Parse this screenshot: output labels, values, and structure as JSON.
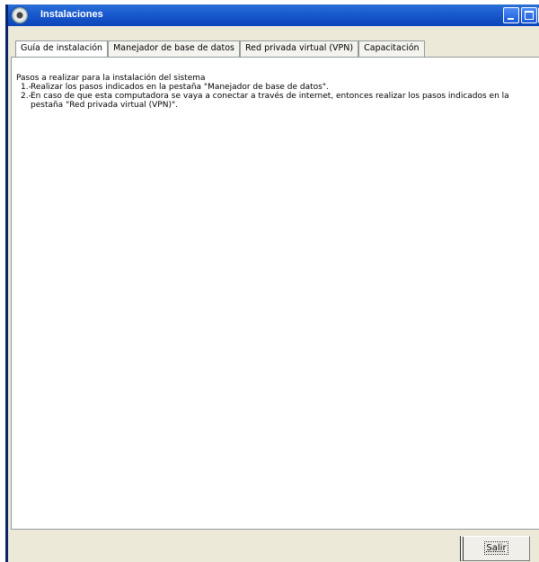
{
  "window": {
    "title": "Instalaciones"
  },
  "tabs": [
    {
      "label": "Guía de instalación",
      "active": true
    },
    {
      "label": "Manejador de base de datos",
      "active": false
    },
    {
      "label": "Red privada virtual (VPN)",
      "active": false
    },
    {
      "label": "Capacitación",
      "active": false
    }
  ],
  "content": {
    "intro": "Pasos a realizar para la instalación del sistema",
    "steps": [
      {
        "num": "1.-",
        "text": "Realizar los pasos indicados en la pestaña \"Manejador de base de datos\"."
      },
      {
        "num": "2.-",
        "text": "En caso de que esta computadora se vaya a conectar a través de internet, entonces realizar los pasos indicados en la pestaña \"Red privada virtual (VPN)\"."
      }
    ]
  },
  "footer": {
    "exit_label": "Salir"
  },
  "icons": {
    "app": "app-icon",
    "minimize": "minimize-icon",
    "maximize": "maximize-icon",
    "close": "close-icon"
  },
  "colors": {
    "titlebar": "#0b45b8",
    "window_bg": "#ece9d8",
    "panel_bg": "#ffffff",
    "close": "#c73a1e"
  }
}
